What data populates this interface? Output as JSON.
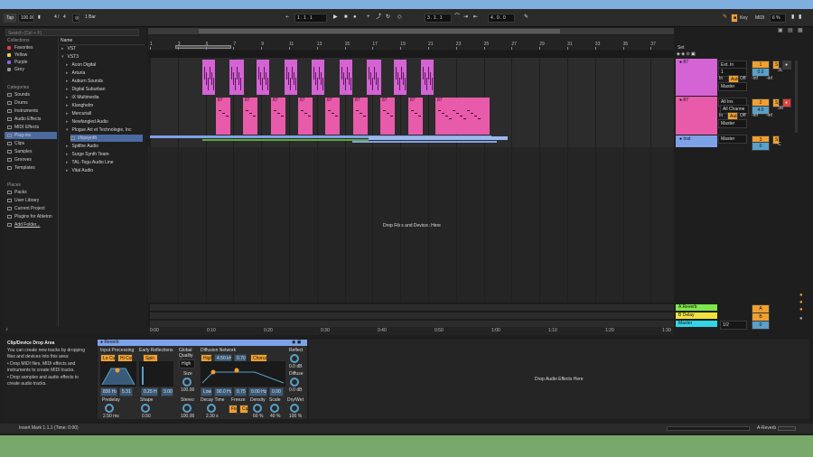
{
  "colors": {
    "accent": "#f0a030",
    "clip_magenta": "#d463d4",
    "clip_pink": "#e85aaa",
    "clip_blue": "#7ea2e8",
    "bg": "#1e1e1e",
    "master_cyan": "#33d4e8",
    "return_green": "#7de84b",
    "return_yellow": "#f0e040"
  },
  "transport": {
    "tap": "Tap",
    "tempo": "100.00",
    "meter_num": "4",
    "meter_den": "4",
    "quant": "1 Bar",
    "position": "1 .  1 .  1",
    "loop_start": "3 .  1 .  1",
    "loop_len": "4 .  0 .  0",
    "key_label": "Key",
    "midi_label": "MIDI",
    "cpu": "6 %",
    "icons": [
      "play-icon",
      "stop-icon",
      "record-icon",
      "metronome-icon",
      "draw-icon"
    ]
  },
  "browser": {
    "search_placeholder": "Search (Ctrl + F)",
    "collections_header": "Collections",
    "collections": [
      {
        "label": "Favorites",
        "color": "#e84040"
      },
      {
        "label": "Yellow",
        "color": "#e8d040"
      },
      {
        "label": "Purple",
        "color": "#9060e0"
      },
      {
        "label": "Grey",
        "color": "#909090"
      }
    ],
    "categories_header": "Categories",
    "categories": [
      "Sounds",
      "Drums",
      "Instruments",
      "Audio Effects",
      "MIDI Effects",
      "Plug-ins",
      "Clips",
      "Samples",
      "Grooves",
      "Templates"
    ],
    "places_header": "Places",
    "places": [
      "Packs",
      "User Library",
      "Current Project",
      "Plugins for Ableton",
      "Add Folder..."
    ],
    "name_header": "Name",
    "items": [
      "VST",
      "VST3",
      "Acon Digital",
      "Arturia",
      "Auburn Sounds",
      "Digital Suburban",
      "iX Multimedia",
      "Klanghelm",
      "Mercuriall",
      "Newfangled Audio",
      "Plogue Art et Technologie, Inc",
      "Spitfire Audio",
      "Surge Synth Team",
      "TAL-Togu Audio Line",
      "Vital Audio"
    ],
    "selected_item": "chipsynth"
  },
  "arrangement": {
    "bar_ticks": [
      "1",
      "3",
      "5",
      "7",
      "9",
      "11",
      "13",
      "15",
      "17",
      "19",
      "21",
      "23",
      "25",
      "27",
      "29",
      "31",
      "33",
      "35",
      "37"
    ],
    "time_ticks": [
      "0:00",
      "0:10",
      "0:20",
      "0:30",
      "0:40",
      "0:50",
      "1:00",
      "1:10",
      "1:20",
      "1:30"
    ],
    "drop_text": "Drop Files and Devices Here",
    "set_label": "Set",
    "clip_label": "87"
  },
  "tracks": [
    {
      "name": "87",
      "input": "Ext. In",
      "channel": "1",
      "monitor": [
        "Auto",
        "Off"
      ],
      "output": "Master",
      "number": "1",
      "vol": "0.0",
      "pan": "3L",
      "sends": [
        "-inf",
        "-inf"
      ]
    },
    {
      "name": "87",
      "input": "All Ins",
      "channel": "All Channe",
      "monitor": [
        "In",
        "Auto",
        "Off"
      ],
      "output": "Master",
      "number": "2",
      "vol": "4.0",
      "pan": "3R",
      "sends": [
        "-inf",
        "-inf"
      ]
    },
    {
      "name": "Inst",
      "output": "Master",
      "number": "3",
      "vol": "0",
      "pan": "C"
    }
  ],
  "returns": [
    {
      "name": "A Reverb",
      "letter": "A"
    },
    {
      "name": "B Delay",
      "letter": "B"
    },
    {
      "name": "Master",
      "cue": "1/2",
      "number": "0"
    }
  ],
  "info": {
    "title": "Clip/Device Drop Area",
    "body": "You can create new tracks by dropping files and devices into this area:",
    "bullets": [
      "Drop MIDI files, MIDI effects and instruments to create MIDI tracks.",
      "Drop samples and audio effects to create audio tracks."
    ]
  },
  "device": {
    "name": "Reverb",
    "input_proc": "Input Processing",
    "lo_cut": "Lo Cut",
    "hi_cut": "Hi Cut",
    "lo_hz": "830 Hz",
    "hi_val": "5.31",
    "predelay_label": "Predelay",
    "predelay": "2.50 ms",
    "early_refl": "Early Reflections",
    "spin": "Spin",
    "spin_hz": "0.25 Hz",
    "spin_val": "3.00",
    "shape_label": "Shape",
    "shape": "0.50",
    "global_quality": "Global Quality",
    "quality": "High",
    "size_label": "Size",
    "size": "100.00",
    "stereo_label": "Stereo",
    "stereo": "100.00",
    "diff_net": "Diffusion Network",
    "high_label": "High",
    "high_hz": "4.50 kHz",
    "high_val": "0.70",
    "chorus": "Chorus",
    "low_label": "Low",
    "low_hz": "90.0 Hz",
    "low_val": "0.75",
    "low_val2": "0.00 Hz",
    "low_val3": "0.00",
    "decay_label": "Decay Time",
    "decay": "2.30 s",
    "freeze_label": "Freeze",
    "flat": "Flat",
    "cut": "Cut",
    "density_label": "Density",
    "density": "60 %",
    "scale_label": "Scale",
    "scale": "40 %",
    "reflect_label": "Reflect",
    "reflect": "0.0 dB",
    "diffuse_label": "Diffuse",
    "diffuse": "0.0 dB",
    "drywet_label": "Dry/Wet",
    "drywet": "100 %"
  },
  "drop_audio_fx": "Drop Audio Effects Here",
  "status": {
    "text": "Insert Mark 1.1.1 (Time: 0:00)",
    "right": "A-Reverb"
  }
}
